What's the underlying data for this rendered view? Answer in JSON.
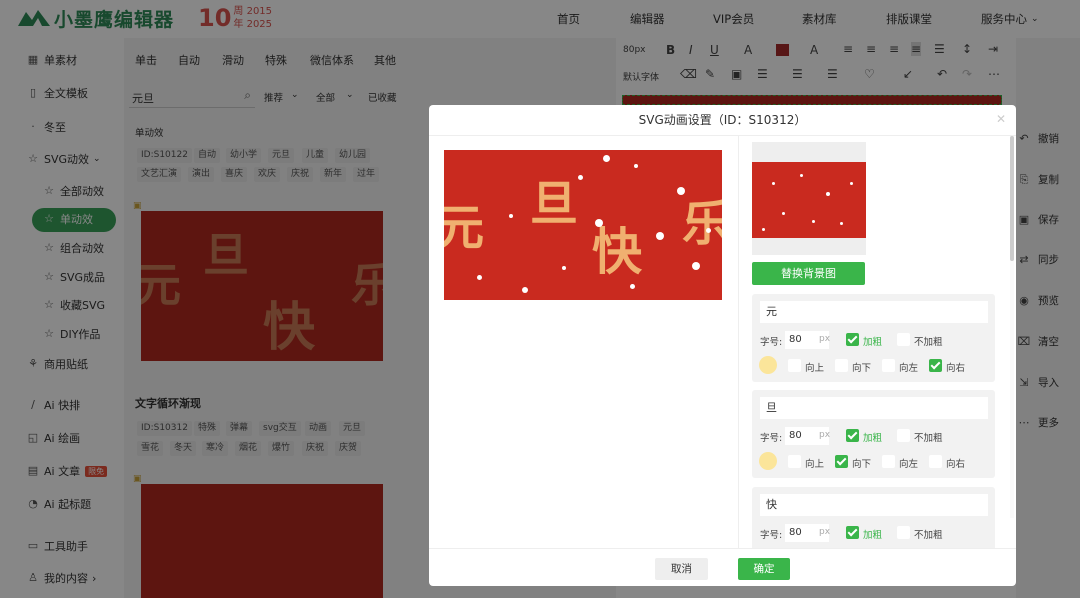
{
  "brand": {
    "logo_text": "小墨鹰编辑器",
    "anniv_num": "10",
    "anniv_year1": "周 2015",
    "anniv_year2": "年 2025"
  },
  "nav": [
    "首页",
    "编辑器",
    "VIP会员",
    "素材库",
    "排版课堂",
    "服务中心"
  ],
  "sidebar": {
    "items": [
      {
        "label": "单素材",
        "icon": "grid-icon"
      },
      {
        "label": "全文模板",
        "icon": "template-icon"
      },
      {
        "label": "冬至",
        "icon": "snow-icon"
      },
      {
        "label": "SVG动效",
        "icon": "star-icon"
      },
      {
        "label": "全部动效",
        "icon": "star-icon"
      },
      {
        "label": "单动效",
        "icon": "star-icon"
      },
      {
        "label": "组合动效",
        "icon": "star-icon"
      },
      {
        "label": "SVG成品",
        "icon": "star-icon"
      },
      {
        "label": "收藏SVG",
        "icon": "star-icon"
      },
      {
        "label": "DIY作品",
        "icon": "star-icon"
      },
      {
        "label": "商用贴纸",
        "icon": "sticker-icon"
      },
      {
        "label": "Ai 快排",
        "icon": "ai-icon"
      },
      {
        "label": "Ai 绘画",
        "icon": "paint-icon"
      },
      {
        "label": "Ai 文章",
        "icon": "doc-icon"
      },
      {
        "label": "Ai 起标题",
        "icon": "title-icon"
      },
      {
        "label": "工具助手",
        "icon": "tool-icon"
      },
      {
        "label": "我的内容",
        "icon": "user-icon"
      }
    ],
    "ai_badge": "限免"
  },
  "panel": {
    "categories": [
      "单击",
      "自动",
      "滑动",
      "特殊",
      "微信体系",
      "其他"
    ],
    "search_value": "元旦",
    "filters": [
      "推荐",
      "全部",
      "已收藏"
    ],
    "section1_title": "单动效",
    "section1_tags": [
      "ID:S10122",
      "自动",
      "幼小学",
      "元旦",
      "儿童",
      "幼儿园",
      "文艺汇演",
      "演出",
      "喜庆",
      "欢庆",
      "庆祝",
      "新年",
      "过年"
    ],
    "thumb1_chars": [
      "元",
      "旦",
      "快",
      "乐"
    ],
    "section2_title": "文字循环渐现",
    "section2_tags": [
      "ID:S10312",
      "特殊",
      "弹幕",
      "svg交互",
      "动画",
      "元旦",
      "雪花",
      "冬天",
      "寒冷",
      "烟花",
      "爆竹",
      "庆祝",
      "庆贺"
    ]
  },
  "editor_toolbar": {
    "font_size": "80px",
    "font_family": "默认字体"
  },
  "rightbar": [
    "撤销",
    "复制",
    "保存",
    "同步",
    "预览",
    "清空",
    "导入",
    "更多"
  ],
  "modal": {
    "title": "SVG动画设置（ID：S10312）",
    "preview_chars": [
      "元",
      "旦",
      "快",
      "乐"
    ],
    "replace_bg_label": "替换背景图",
    "size_label": "字号:",
    "unit": "px",
    "bold_label": "加粗",
    "not_bold_label": "不加粗",
    "dir_up": "向上",
    "dir_down": "向下",
    "dir_left": "向左",
    "dir_right": "向右",
    "blocks": [
      {
        "char": "元",
        "size": "80",
        "bold": true,
        "direction": "right"
      },
      {
        "char": "旦",
        "size": "80",
        "bold": true,
        "direction": "down"
      },
      {
        "char": "快",
        "size": "80",
        "bold": true
      }
    ],
    "cancel_label": "取消",
    "ok_label": "确定",
    "colors": {
      "accent": "#3ab54a",
      "preview_bg": "#c92a1f",
      "char_color": "#fbe59a"
    }
  }
}
